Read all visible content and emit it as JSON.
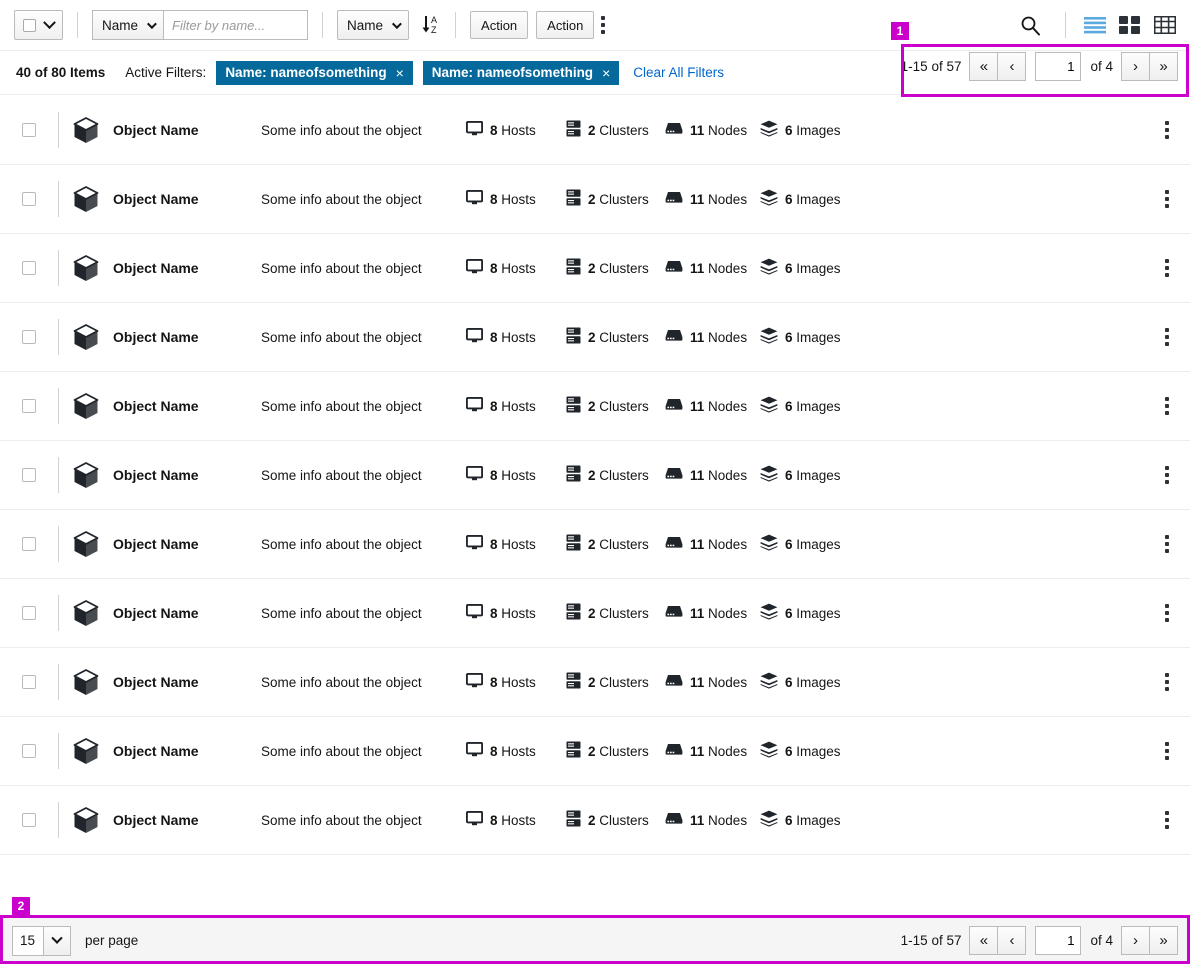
{
  "toolbar": {
    "bulk_select": {
      "name": "select-all",
      "checked": false
    },
    "filter_select_label": "Name",
    "filter_placeholder": "Filter by name...",
    "filter_value": "",
    "sort_select_label": "Name",
    "sort_direction_icon": "sort-alpha-down-icon",
    "actions": [
      {
        "label": "Action"
      },
      {
        "label": "Action"
      }
    ],
    "overflow_icon": "kebab-menu-icon",
    "search_icon": "search-icon",
    "view_toggles": [
      {
        "name": "list-view",
        "icon": "list-view-icon",
        "active": true
      },
      {
        "name": "card-view",
        "icon": "grid-view-icon",
        "active": false
      },
      {
        "name": "table-view",
        "icon": "table-view-icon",
        "active": false
      }
    ]
  },
  "filter_bar": {
    "items_count": "40 of 80 Items",
    "active_filters_label": "Active Filters:",
    "chips": [
      {
        "label": "Name: nameofsomething",
        "close": "×"
      },
      {
        "label": "Name: nameofsomething",
        "close": "×"
      }
    ],
    "clear_all_label": "Clear All Filters"
  },
  "pagination": {
    "range": "1-15 of 57",
    "first_label": "«",
    "prev_label": "‹",
    "page_value": "1",
    "of_label": "of 4",
    "next_label": "›",
    "last_label": "»"
  },
  "bottom_bar": {
    "per_page_value": "15",
    "per_page_label": "per page",
    "pagination": {
      "range": "1-15 of 57",
      "first_label": "«",
      "prev_label": "‹",
      "page_value": "1",
      "of_label": "of 4",
      "next_label": "›",
      "last_label": "»"
    }
  },
  "list": {
    "row_labels": {
      "name": "Object Name",
      "description": "Some info about the object",
      "hosts_count": "8",
      "hosts_label": "Hosts",
      "clusters_count": "2",
      "clusters_label": "Clusters",
      "nodes_count": "11",
      "nodes_label": "Nodes",
      "images_count": "6",
      "images_label": "Images"
    },
    "rows": [
      {
        "name": "Object Name",
        "description": "Some info about the object",
        "hosts": "8",
        "clusters": "2",
        "nodes": "11",
        "images": "6"
      },
      {
        "name": "Object Name",
        "description": "Some info about the object",
        "hosts": "8",
        "clusters": "2",
        "nodes": "11",
        "images": "6"
      },
      {
        "name": "Object Name",
        "description": "Some info about the object",
        "hosts": "8",
        "clusters": "2",
        "nodes": "11",
        "images": "6"
      },
      {
        "name": "Object Name",
        "description": "Some info about the object",
        "hosts": "8",
        "clusters": "2",
        "nodes": "11",
        "images": "6"
      },
      {
        "name": "Object Name",
        "description": "Some info about the object",
        "hosts": "8",
        "clusters": "2",
        "nodes": "11",
        "images": "6"
      },
      {
        "name": "Object Name",
        "description": "Some info about the object",
        "hosts": "8",
        "clusters": "2",
        "nodes": "11",
        "images": "6"
      },
      {
        "name": "Object Name",
        "description": "Some info about the object",
        "hosts": "8",
        "clusters": "2",
        "nodes": "11",
        "images": "6"
      },
      {
        "name": "Object Name",
        "description": "Some info about the object",
        "hosts": "8",
        "clusters": "2",
        "nodes": "11",
        "images": "6"
      },
      {
        "name": "Object Name",
        "description": "Some info about the object",
        "hosts": "8",
        "clusters": "2",
        "nodes": "11",
        "images": "6"
      },
      {
        "name": "Object Name",
        "description": "Some info about the object",
        "hosts": "8",
        "clusters": "2",
        "nodes": "11",
        "images": "6"
      },
      {
        "name": "Object Name",
        "description": "Some info about the object",
        "hosts": "8",
        "clusters": "2",
        "nodes": "11",
        "images": "6"
      }
    ]
  },
  "annotations": [
    {
      "id": "1",
      "label": "1"
    },
    {
      "id": "2",
      "label": "2"
    }
  ],
  "colors": {
    "chip_blue": "#06699c",
    "link_blue": "#0066cc",
    "annotation_magenta": "#cc00cc",
    "icon_dark": "#2b3136",
    "active_view_blue": "#5ba9e0"
  }
}
